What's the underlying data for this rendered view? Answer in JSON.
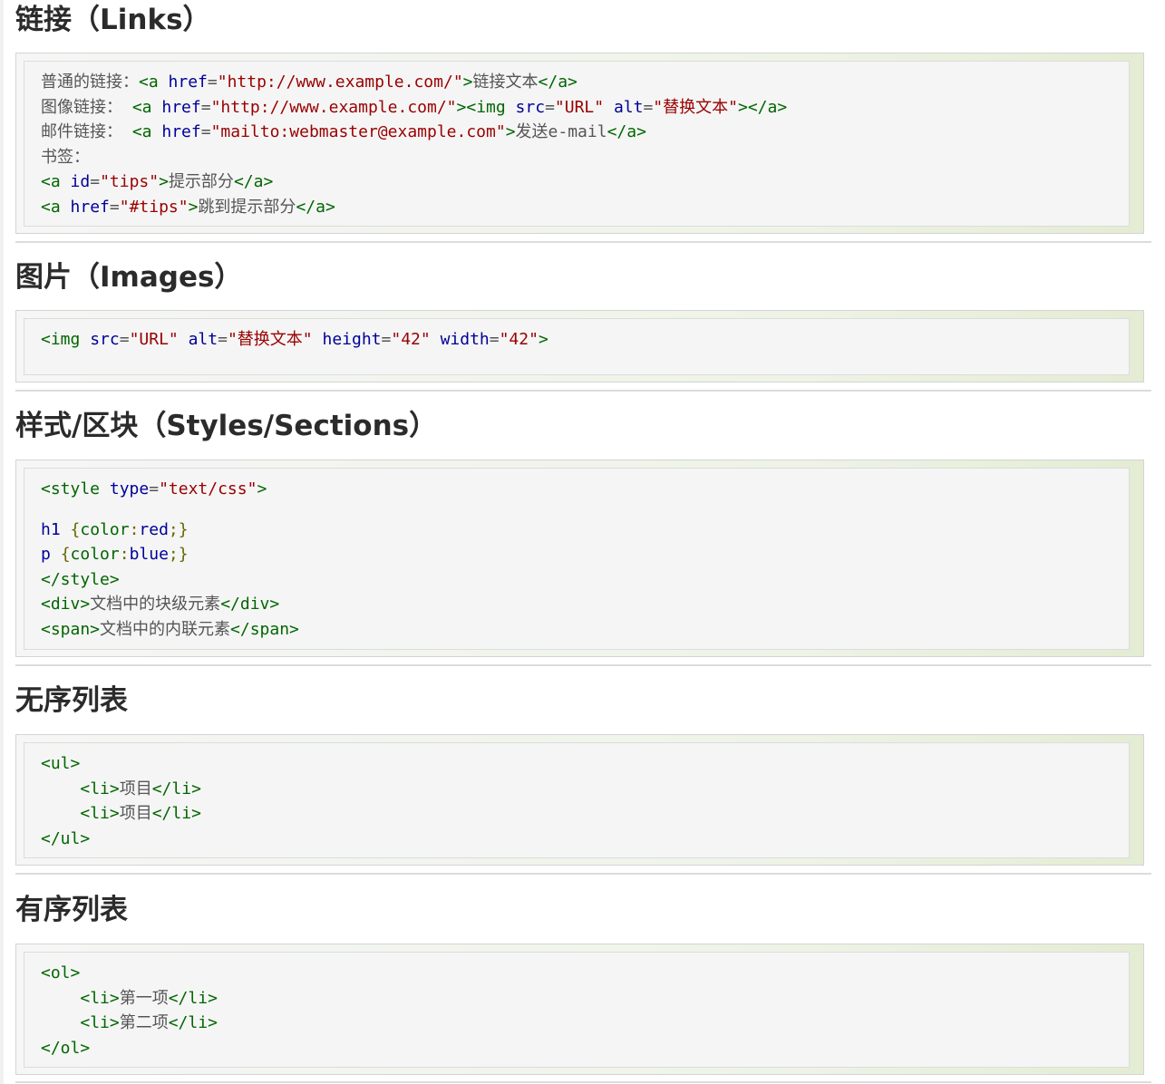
{
  "sections": [
    {
      "title": "链接（Links）"
    },
    {
      "title": "图片（Images）"
    },
    {
      "title": "样式/区块（Styles/Sections）"
    },
    {
      "title": "无序列表"
    },
    {
      "title": "有序列表"
    }
  ],
  "links": {
    "normal_label": "普通的链接：",
    "href_attr": "href",
    "url": "\"http://www.example.com/\"",
    "link_text": "链接文本",
    "image_label": "图像链接：",
    "img_src_val": "\"URL\"",
    "img_alt_val": "\"替换文本\"",
    "mail_label": "邮件链接：",
    "mail_val": "\"mailto:webmaster@example.com\"",
    "mail_text": "发送e-mail",
    "bookmark_label": "书签：",
    "id_val": "\"tips\"",
    "tips_text": "提示部分",
    "hash_val": "\"#tips\"",
    "jump_text": "跳到提示部分"
  },
  "images": {
    "src_val": "\"URL\"",
    "alt_val": "\"替换文本\"",
    "height_val": "\"42\"",
    "width_val": "\"42\""
  },
  "styles": {
    "type_val": "\"text/css\"",
    "h1_sel": "h1",
    "p_sel": "p",
    "prop": "color",
    "red": "red",
    "blue": "blue",
    "div_text": "文档中的块级元素",
    "span_text": "文档中的内联元素"
  },
  "ul": {
    "item1": "项目",
    "item2": "项目"
  },
  "ol": {
    "item1": "第一项",
    "item2": "第二项"
  }
}
